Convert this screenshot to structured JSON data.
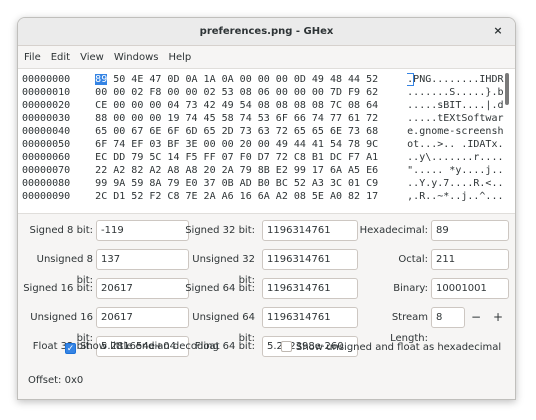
{
  "window": {
    "title": "preferences.png - GHex",
    "close_glyph": "×"
  },
  "menu": [
    "File",
    "Edit",
    "View",
    "Windows",
    "Help"
  ],
  "hex_rows": [
    {
      "offset": "00000000",
      "hex_first": "89",
      "hex_rest": " 50 4E 47 0D 0A 1A 0A 00 00 00 0D 49 48 44 52",
      "ascii_first": ".",
      "ascii_rest": "PNG........IHDR"
    },
    {
      "offset": "00000010",
      "hex_first": "00",
      "hex_rest": " 00 02 F8 00 00 02 53 08 06 00 00 00 7D F9 62",
      "ascii_first": ".",
      "ascii_rest": "......S.....}.b"
    },
    {
      "offset": "00000020",
      "hex_first": "CE",
      "hex_rest": " 00 00 00 04 73 42 49 54 08 08 08 08 7C 08 64",
      "ascii_first": ".",
      "ascii_rest": "....sBIT....|.d"
    },
    {
      "offset": "00000030",
      "hex_first": "88",
      "hex_rest": " 00 00 00 19 74 45 58 74 53 6F 66 74 77 61 72",
      "ascii_first": ".",
      "ascii_rest": "....tEXtSoftwar"
    },
    {
      "offset": "00000040",
      "hex_first": "65",
      "hex_rest": " 00 67 6E 6F 6D 65 2D 73 63 72 65 65 6E 73 68",
      "ascii_first": "e",
      "ascii_rest": ".gnome-screensh"
    },
    {
      "offset": "00000050",
      "hex_first": "6F",
      "hex_rest": " 74 EF 03 BF 3E 00 00 20 00 49 44 41 54 78 9C",
      "ascii_first": "o",
      "ascii_rest": "t...>.. .IDATx."
    },
    {
      "offset": "00000060",
      "hex_first": "EC",
      "hex_rest": " DD 79 5C 14 F5 FF 07 F0 D7 72 C8 B1 DC F7 A1",
      "ascii_first": ".",
      "ascii_rest": ".y\\.......r...."
    },
    {
      "offset": "00000070",
      "hex_first": "22",
      "hex_rest": " A2 82 A2 A8 A8 20 2A 79 8B E2 99 17 6A A5 E6",
      "ascii_first": "\"",
      "ascii_rest": "..... *y....j.."
    },
    {
      "offset": "00000080",
      "hex_first": "99",
      "hex_rest": " 9A 59 8A 79 E0 37 0B AD B0 BC 52 A3 3C 01 C9",
      "ascii_first": ".",
      "ascii_rest": ".Y.y.7....R.<.."
    },
    {
      "offset": "00000090",
      "hex_first": "2C",
      "hex_rest": " D1 52 F2 C8 7E 2A A6 16 6A A2 08 5E A0 82 17",
      "ascii_first": ",",
      "ascii_rest": ".R..~*..j..^..."
    }
  ],
  "fields": {
    "signed8": {
      "label": "Signed 8 bit:",
      "value": "-119"
    },
    "signed32": {
      "label": "Signed 32 bit:",
      "value": "1196314761"
    },
    "hexadecimal": {
      "label": "Hexadecimal:",
      "value": "89"
    },
    "unsigned8": {
      "label": "Unsigned 8 bit:",
      "value": "137"
    },
    "unsigned32": {
      "label": "Unsigned 32 bit:",
      "value": "1196314761"
    },
    "octal": {
      "label": "Octal:",
      "value": "211"
    },
    "signed16": {
      "label": "Signed 16 bit:",
      "value": "20617"
    },
    "signed64": {
      "label": "Signed 64 bit:",
      "value": "1196314761"
    },
    "binary": {
      "label": "Binary:",
      "value": "10001001"
    },
    "unsigned16": {
      "label": "Unsigned 16 bit:",
      "value": "20617"
    },
    "unsigned64": {
      "label": "Unsigned 64 bit:",
      "value": "1196314761"
    },
    "stream_length": {
      "label": "Stream Length:",
      "value": "8",
      "minus": "−",
      "plus": "+"
    },
    "float32": {
      "label": "Float 32 bit:",
      "value": "5.281654e+04"
    },
    "float64": {
      "label": "Float 64 bit:",
      "value": "5.292398e-260"
    }
  },
  "options": {
    "little_endian": {
      "label": "Show little endian decoding",
      "checked": true,
      "check_glyph": "✓"
    },
    "unsigned_hex": {
      "label": "Show unsigned and float as hexadecimal",
      "checked": false
    }
  },
  "status": {
    "offset": "Offset: 0x0"
  },
  "colors": {
    "accent": "#3584e4"
  }
}
